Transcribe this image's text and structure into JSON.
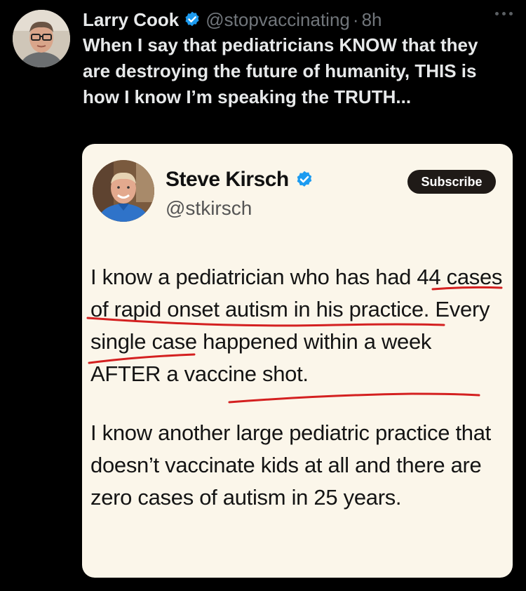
{
  "author": {
    "name": "Larry Cook",
    "handle": "@stopvaccinating",
    "separator": "·",
    "time": "8h"
  },
  "tweet_text": "When I say that pediatricians KNOW that they are destroying the future of humanity, THIS is how I know I’m speaking the TRUTH...",
  "quote": {
    "name": "Steve Kirsch",
    "handle": "@stkirsch",
    "subscribe_label": "Subscribe",
    "paragraph1": "I know a pediatrician who has had 44 cases of rapid onset autism in his practice. Every single case happened within a week AFTER a vaccine shot.",
    "paragraph2": "I know another large pediatric practice that doesn’t vaccinate kids at all and there are zero cases of autism in 25 years."
  },
  "colors": {
    "background": "#000000",
    "verified": "#1d9bf0",
    "card": "#fbf6ea",
    "underline": "#d42020"
  },
  "icons": [
    "verified-badge-icon",
    "more-options-icon"
  ]
}
